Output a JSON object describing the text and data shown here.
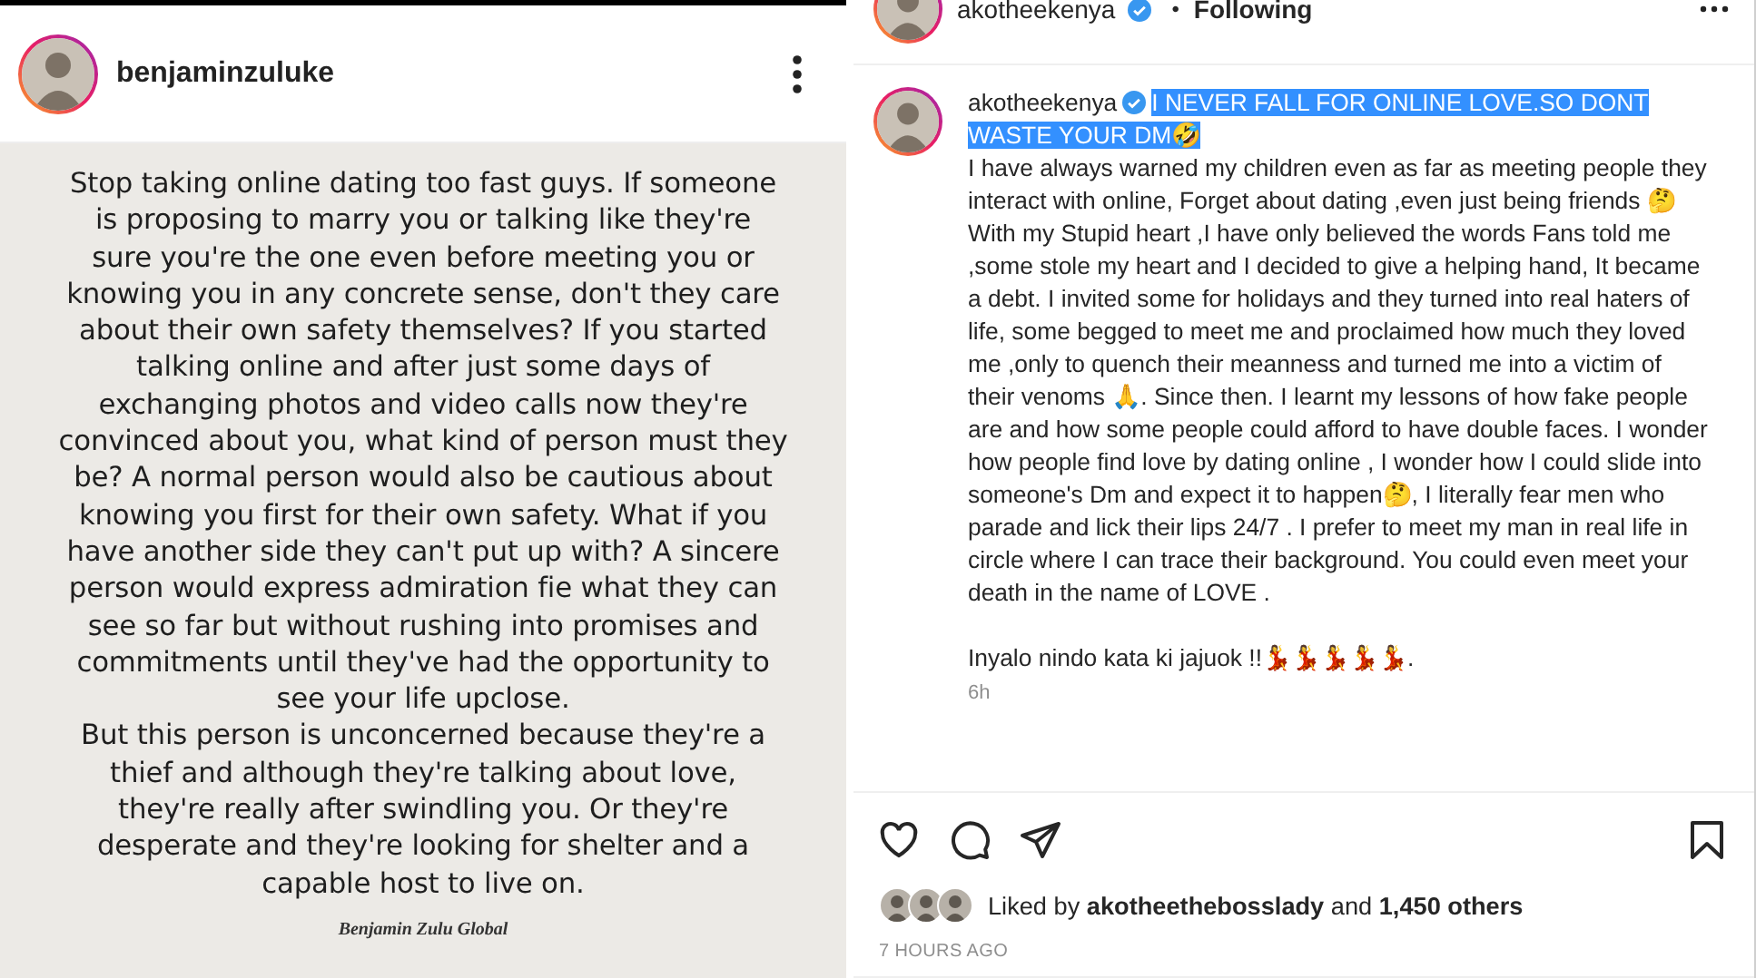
{
  "shared_post": {
    "username": "benjaminzuluke",
    "image_paragraphs": [
      "Stop taking online dating too fast guys. If someone\nis proposing to marry you or talking like they're\nsure you're the one even before meeting you or\nknowing you in any concrete sense, don't they care\nabout their own safety themselves? If you started\ntalking online and after just some days of\nexchanging photos and video calls now they're\nconvinced about you, what kind of person must they\nbe? A normal person would also be cautious about\nknowing you first for their own safety. What if you\nhave another side they can't put up with? A sincere\nperson would express admiration fie what they can\nsee so far but without rushing into promises and\ncommitments until they've had the opportunity to",
      "see your life upclose.\nBut this person is unconcerned because they're a\nthief and although they're talking about love,\nthey're really after swindling you. Or they're\ndesperate and they're looking for shelter and a\ncapable host to live on."
    ],
    "signature": "Benjamin Zulu Global"
  },
  "post_header": {
    "username": "akotheekenya",
    "verified": true,
    "separator": "•",
    "follow_status": "Following"
  },
  "caption": {
    "username": "akotheekenya",
    "verified": true,
    "headline": "I NEVER FALL FOR ONLINE LOVE.SO DONT WASTE YOUR DM🤣",
    "headline_selected": true,
    "body": "I have always warned my children even as far as meeting people they interact with online, Forget about dating ,even just being friends 🤔With my Stupid heart ,I have only believed the words Fans told me ,some stole my heart and I decided to give a helping hand, It became a debt. I invited some for holidays and they turned into real haters of life, some begged to meet me and proclaimed how much they loved me ,only to quench their meanness and turned me into a victim of their venoms 🙏. Since then. I learnt my lessons of how fake people are and how some people could afford to have double faces. I wonder how people find love by dating online , I wonder how I could slide into someone's Dm and expect it to happen🤔, I literally fear men who parade and lick their lips 24/7 . I prefer to meet my man in real life in circle where I can trace their background. You could even meet your death in the name of LOVE .",
    "closing": "Inyalo nindo kata ki jajuok !!💃💃💃💃💃.",
    "age": "6h"
  },
  "likes": {
    "text": "Liked by **akotheethebosslady** and **1,450 others**",
    "liked": false,
    "saved": false
  },
  "timestamp": "7 HOURS AGO"
}
